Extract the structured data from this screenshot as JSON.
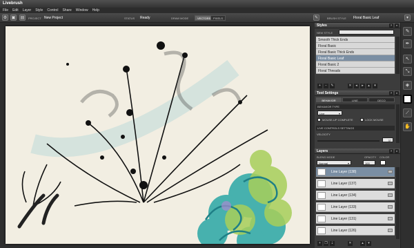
{
  "app": {
    "title": "Livebrush"
  },
  "menu": [
    "File",
    "Edit",
    "Layer",
    "Style",
    "Control",
    "Share",
    "Window",
    "Help"
  ],
  "toolbar": {
    "project_label": "PROJECT",
    "project_value": "New Project",
    "status_label": "STATUS",
    "status_value": "Ready",
    "draw_mode_label": "DRAW MODE",
    "mode_vectors": "VECTORS",
    "mode_pixels": "PIXELS",
    "brush_style_label": "BRUSH STYLE",
    "brush_style_value": "Floral Basic Leaf"
  },
  "styles_panel": {
    "title": "Styles",
    "new_style_label": "NEW STYLE",
    "items": [
      "Smooth Thick Ends",
      "Floral Basic",
      "Floral Basic Thick Ends",
      "Floral Basic Leaf",
      "Floral Basic 2",
      "Floral Threads"
    ],
    "selected_index": 3
  },
  "tool_settings": {
    "title": "Tool Settings",
    "tabs": [
      "BEHAVIOR",
      "LINE",
      "DECO"
    ],
    "behavior_type_label": "BEHAVIOR TYPE",
    "behavior_type_value": "Live",
    "mouse_up_complete": "MOUSE-UP COMPLETE",
    "lock_mouse": "LOCK MOUSE",
    "live_controls_label": "LIVE CONTROLS SETTINGS",
    "velocity_label": "VELOCITY",
    "velocity_value": "37"
  },
  "layers_panel": {
    "title": "Layers",
    "blend_mode_label": "BLEND MODE",
    "blend_mode_value": "Normal",
    "opacity_label": "OPACITY",
    "opacity_value": "100",
    "color_label": "COLOR",
    "items": [
      "Line Layer (138)",
      "Line Layer (137)",
      "Line Layer (134)",
      "Line Layer (133)",
      "Line Layer (131)",
      "Line Layer (126)"
    ],
    "selected_index": 0
  },
  "colors": {
    "accent": "#7a8ea3",
    "canvas": "#f2eee2"
  }
}
